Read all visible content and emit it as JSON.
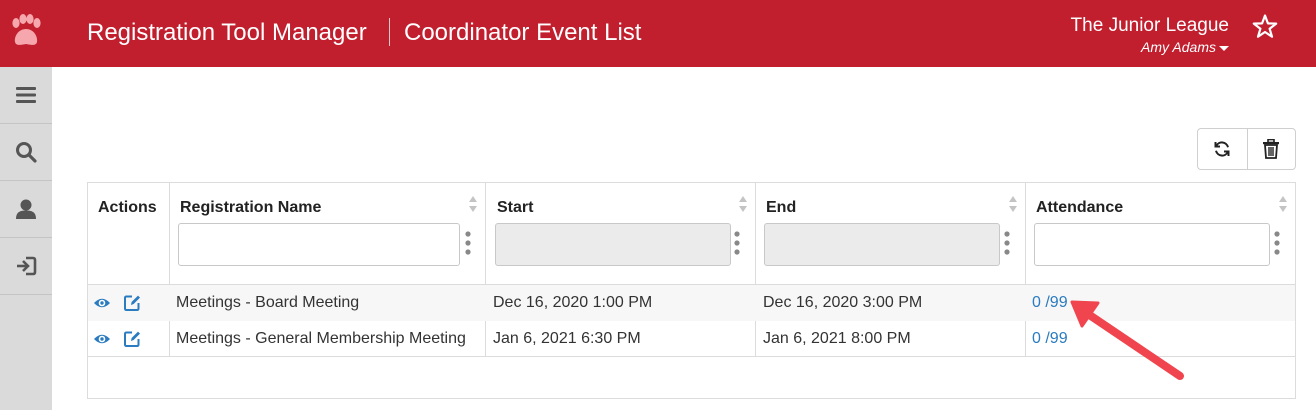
{
  "header": {
    "app_title": "Registration Tool Manager",
    "page_title": "Coordinator Event List",
    "organization": "The Junior League",
    "user": "Amy Adams",
    "brand_color": "#c11e2e"
  },
  "sidebar": {
    "items": [
      {
        "icon": "menu-icon"
      },
      {
        "icon": "search-icon"
      },
      {
        "icon": "user-icon"
      },
      {
        "icon": "logout-icon"
      }
    ]
  },
  "toolbar": {
    "buttons": [
      {
        "icon": "refresh-icon"
      },
      {
        "icon": "trash-icon"
      }
    ]
  },
  "table": {
    "columns": [
      "Actions",
      "Registration Name",
      "Start",
      "End",
      "Attendance"
    ],
    "filters": {
      "registration_name": "",
      "attendance": ""
    },
    "rows": [
      {
        "name": "Meetings - Board Meeting",
        "start": "Dec 16, 2020 1:00 PM",
        "end": "Dec 16, 2020 3:00 PM",
        "attendance": "0 /99"
      },
      {
        "name": "Meetings - General Membership Meeting",
        "start": "Jan 6, 2021 6:30 PM",
        "end": "Jan 6, 2021 8:00 PM",
        "attendance": "0 /99"
      }
    ]
  },
  "annotation": {
    "color": "#f0454e",
    "icon": "arrow-annotation"
  }
}
